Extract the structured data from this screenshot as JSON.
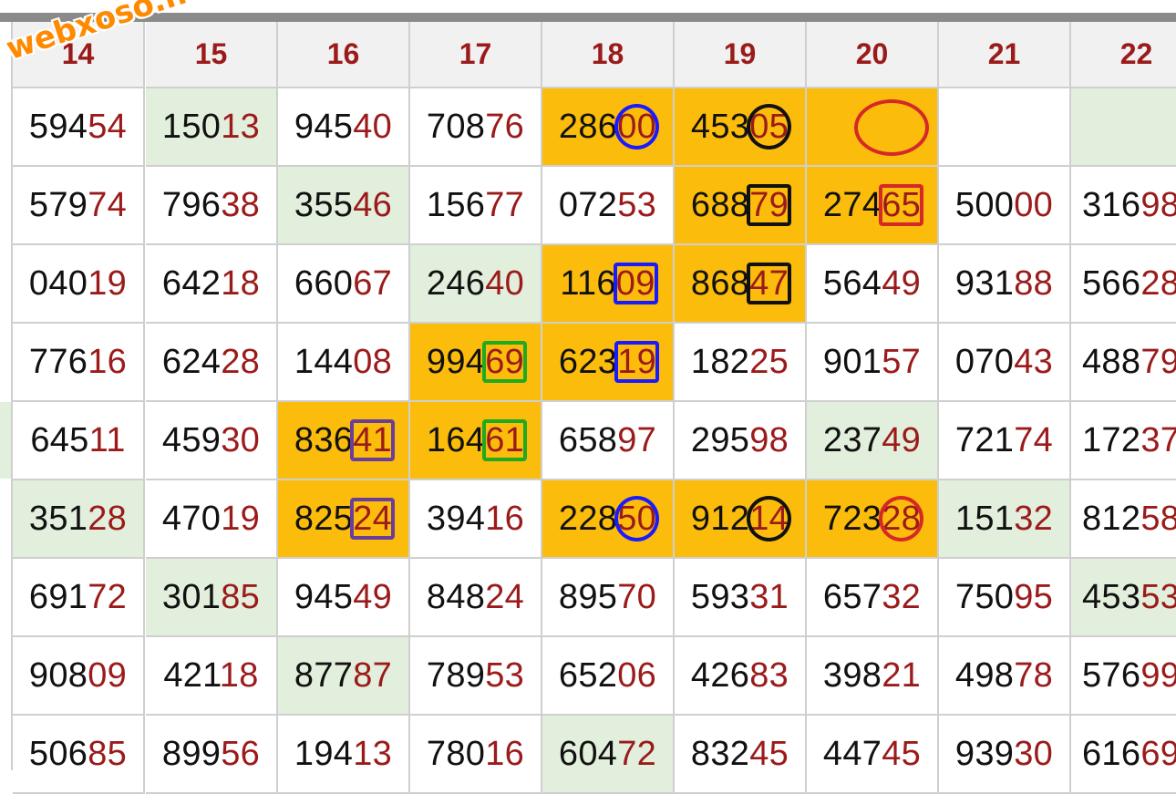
{
  "watermark": "webxoso.net",
  "colors": {
    "number": "#111111",
    "tail": "#9b1b1b",
    "orange": "#fbbc0c",
    "green": "#e2efdc",
    "blue": "#1a1aff",
    "black": "#111111",
    "red": "#d62828",
    "purple": "#6a3d9a",
    "greenMark": "#1faa1f"
  },
  "headers": [
    "14",
    "15",
    "16",
    "17",
    "18",
    "19",
    "20",
    "21",
    "22"
  ],
  "rows": [
    [
      "59454",
      "15013",
      "94540",
      "70876",
      "28600",
      "45305",
      "",
      "",
      ""
    ],
    [
      "57974",
      "79638",
      "35546",
      "15677",
      "07253",
      "68879",
      "27465",
      "50000",
      "31698"
    ],
    [
      "04019",
      "64218",
      "66067",
      "24640",
      "11609",
      "86847",
      "56449",
      "93188",
      "56628"
    ],
    [
      "77616",
      "62428",
      "14408",
      "99469",
      "62319",
      "18225",
      "90157",
      "07043",
      "48879"
    ],
    [
      "64511",
      "45930",
      "83641",
      "16461",
      "65897",
      "29598",
      "23749",
      "72174",
      "17237"
    ],
    [
      "35128",
      "47019",
      "82524",
      "39416",
      "22850",
      "91214",
      "72328",
      "15132",
      "81258"
    ],
    [
      "69172",
      "30185",
      "94549",
      "84824",
      "89570",
      "59331",
      "65732",
      "75095",
      "45353"
    ],
    [
      "90809",
      "42118",
      "87787",
      "78953",
      "65206",
      "42683",
      "39821",
      "49878",
      "57699"
    ],
    [
      "50685",
      "89956",
      "19413",
      "78016",
      "60472",
      "83245",
      "44745",
      "93930",
      "61669"
    ]
  ],
  "highlights": [
    {
      "r": 0,
      "c": 4,
      "fill": "orange"
    },
    {
      "r": 0,
      "c": 5,
      "fill": "orange"
    },
    {
      "r": 0,
      "c": 6,
      "fill": "orange"
    },
    {
      "r": 0,
      "c": 1,
      "fill": "green"
    },
    {
      "r": 0,
      "c": 8,
      "fill": "green"
    },
    {
      "r": 1,
      "c": 5,
      "fill": "orange"
    },
    {
      "r": 1,
      "c": 6,
      "fill": "orange"
    },
    {
      "r": 1,
      "c": 2,
      "fill": "green"
    },
    {
      "r": 2,
      "c": 4,
      "fill": "orange"
    },
    {
      "r": 2,
      "c": 5,
      "fill": "orange"
    },
    {
      "r": 2,
      "c": 3,
      "fill": "green"
    },
    {
      "r": 3,
      "c": 3,
      "fill": "orange"
    },
    {
      "r": 3,
      "c": 4,
      "fill": "orange"
    },
    {
      "r": 4,
      "c": 2,
      "fill": "orange"
    },
    {
      "r": 4,
      "c": 3,
      "fill": "orange"
    },
    {
      "r": 4,
      "c": 6,
      "fill": "green"
    },
    {
      "r": 5,
      "c": 2,
      "fill": "orange"
    },
    {
      "r": 5,
      "c": 4,
      "fill": "orange"
    },
    {
      "r": 5,
      "c": 5,
      "fill": "orange"
    },
    {
      "r": 5,
      "c": 6,
      "fill": "orange"
    },
    {
      "r": 5,
      "c": 0,
      "fill": "green"
    },
    {
      "r": 5,
      "c": 7,
      "fill": "green"
    },
    {
      "r": 6,
      "c": 1,
      "fill": "green"
    },
    {
      "r": 6,
      "c": 8,
      "fill": "green"
    },
    {
      "r": 7,
      "c": 2,
      "fill": "green"
    },
    {
      "r": 8,
      "c": 4,
      "fill": "green"
    }
  ],
  "marks": [
    {
      "r": 0,
      "c": 4,
      "shape": "circle",
      "color": "blue"
    },
    {
      "r": 2,
      "c": 4,
      "shape": "box",
      "color": "blue"
    },
    {
      "r": 3,
      "c": 4,
      "shape": "box",
      "color": "blue"
    },
    {
      "r": 5,
      "c": 4,
      "shape": "circle",
      "color": "blue"
    },
    {
      "r": 0,
      "c": 5,
      "shape": "circle",
      "color": "black"
    },
    {
      "r": 1,
      "c": 5,
      "shape": "box",
      "color": "black"
    },
    {
      "r": 2,
      "c": 5,
      "shape": "box",
      "color": "black"
    },
    {
      "r": 5,
      "c": 5,
      "shape": "circle",
      "color": "black"
    },
    {
      "r": 0,
      "c": 6,
      "shape": "circle",
      "color": "red",
      "empty": true
    },
    {
      "r": 1,
      "c": 6,
      "shape": "box",
      "color": "red"
    },
    {
      "r": 5,
      "c": 6,
      "shape": "circle",
      "color": "red"
    },
    {
      "r": 3,
      "c": 3,
      "shape": "box",
      "color": "greenMark"
    },
    {
      "r": 4,
      "c": 3,
      "shape": "box",
      "color": "greenMark"
    },
    {
      "r": 4,
      "c": 2,
      "shape": "box",
      "color": "purple"
    },
    {
      "r": 5,
      "c": 2,
      "shape": "box",
      "color": "purple"
    }
  ]
}
